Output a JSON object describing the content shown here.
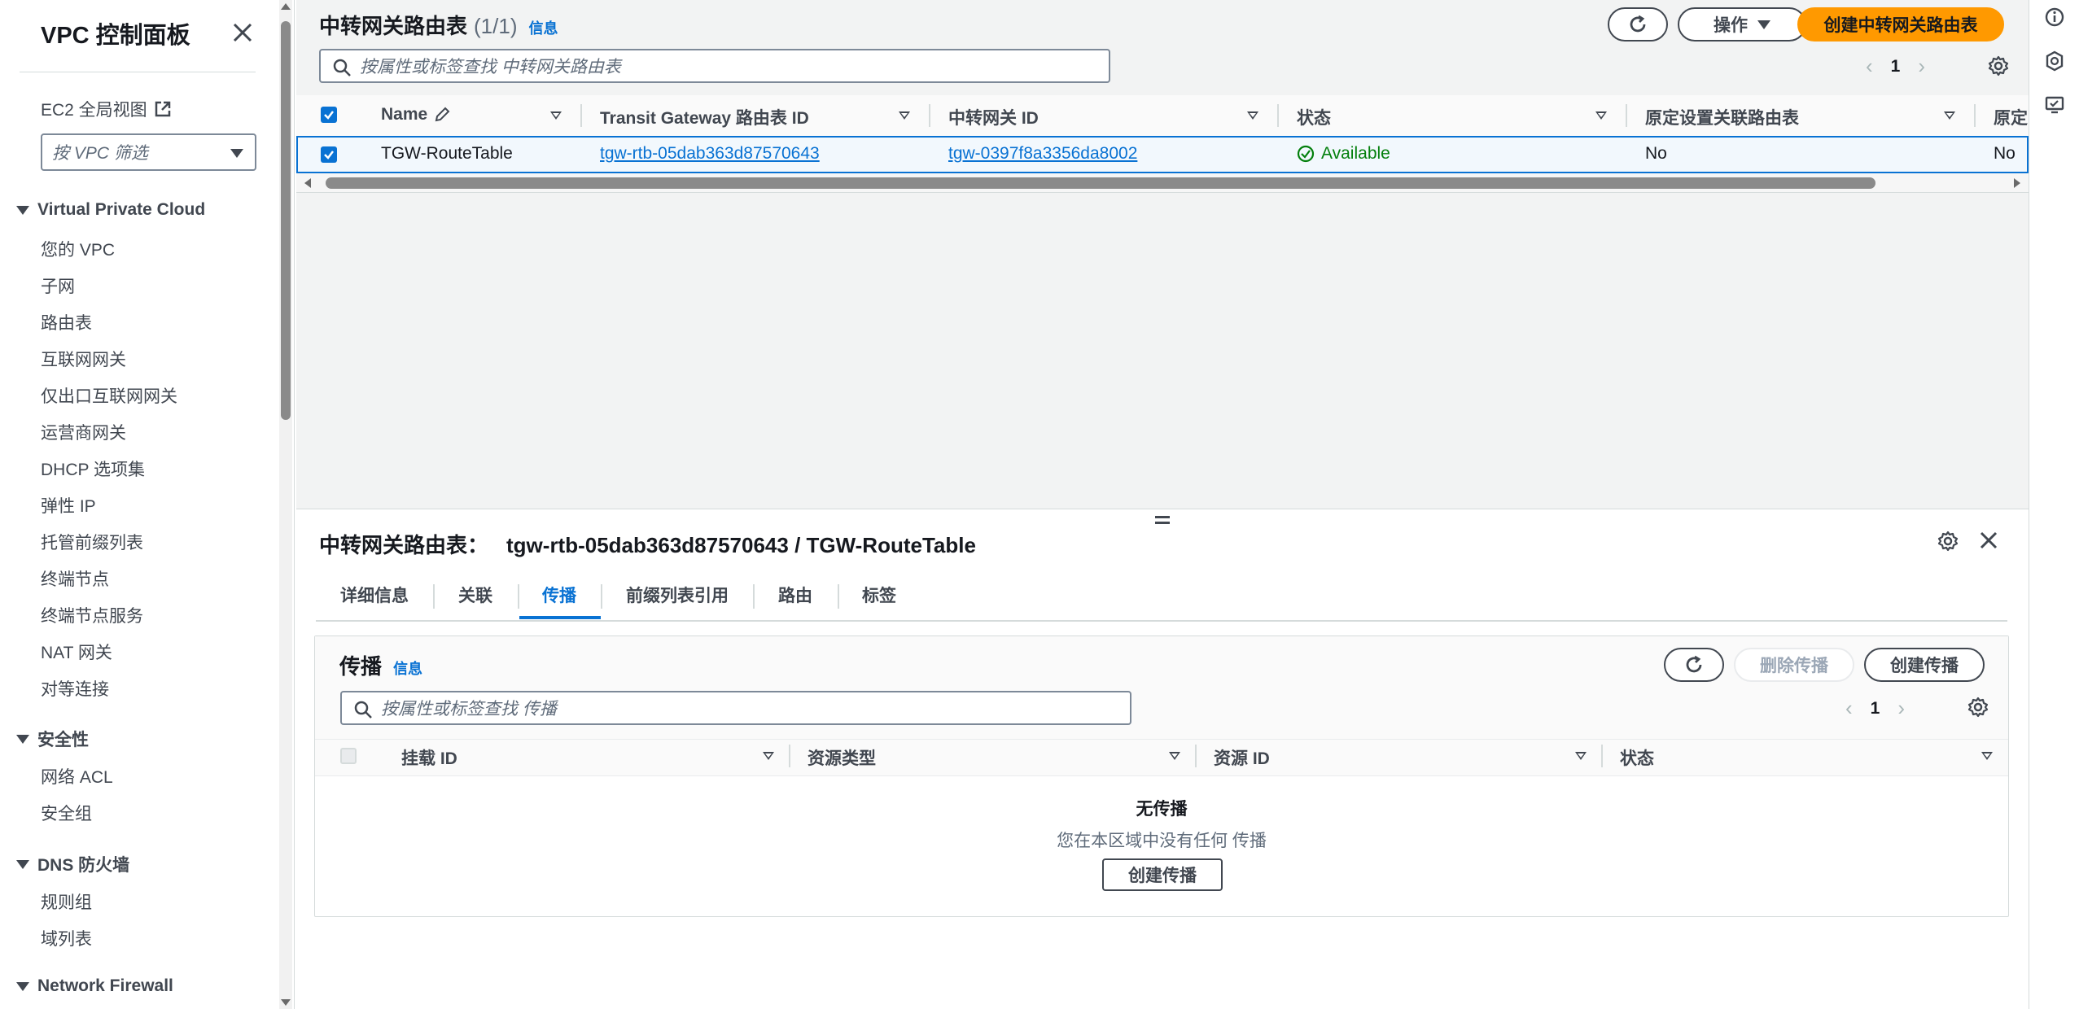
{
  "sidebar": {
    "title": "VPC 控制面板",
    "ec2_global_view": "EC2 全局视图",
    "filter_placeholder": "按 VPC 筛选",
    "sections": [
      {
        "label": "Virtual Private Cloud",
        "items": [
          "您的 VPC",
          "子网",
          "路由表",
          "互联网网关",
          "仅出口互联网网关",
          "运营商网关",
          "DHCP 选项集",
          "弹性 IP",
          "托管前缀列表",
          "终端节点",
          "终端节点服务",
          "NAT 网关",
          "对等连接"
        ]
      },
      {
        "label": "安全性",
        "items": [
          "网络 ACL",
          "安全组"
        ]
      },
      {
        "label": "DNS 防火墙",
        "items": [
          "规则组",
          "域列表"
        ]
      },
      {
        "label": "Network Firewall",
        "items": []
      }
    ]
  },
  "header": {
    "title": "中转网关路由表",
    "count": "(1/1)",
    "info": "信息",
    "actions_label": "操作",
    "create_label": "创建中转网关路由表",
    "search_placeholder": "按属性或标签查找 中转网关路由表",
    "page": "1"
  },
  "table": {
    "columns": [
      "Name",
      "Transit Gateway 路由表 ID",
      "中转网关 ID",
      "状态",
      "原定设置关联路由表",
      "原定"
    ],
    "rows": [
      {
        "name": "TGW-RouteTable",
        "rtb_id": "tgw-rtb-05dab363d87570643",
        "tgw_id": "tgw-0397f8a3356da8002",
        "state": "Available",
        "default_assoc": "No",
        "default_prop": "No"
      }
    ]
  },
  "detail": {
    "title_label": "中转网关路由表：",
    "title_value": "tgw-rtb-05dab363d87570643 / TGW-RouteTable",
    "tabs": [
      "详细信息",
      "关联",
      "传播",
      "前缀列表引用",
      "路由",
      "标签"
    ],
    "active_tab": "传播",
    "section_title": "传播",
    "info": "信息",
    "delete_label": "删除传播",
    "create_label": "创建传播",
    "search_placeholder": "按属性或标签查找 传播",
    "page": "1",
    "columns": [
      "挂载 ID",
      "资源类型",
      "资源 ID",
      "状态"
    ],
    "empty_title": "无传播",
    "empty_desc": "您在本区域中没有任何 传播",
    "empty_button": "创建传播"
  },
  "colors": {
    "accent": "#0972d3",
    "primary_button": "#ff9900",
    "success": "#037f0c"
  }
}
